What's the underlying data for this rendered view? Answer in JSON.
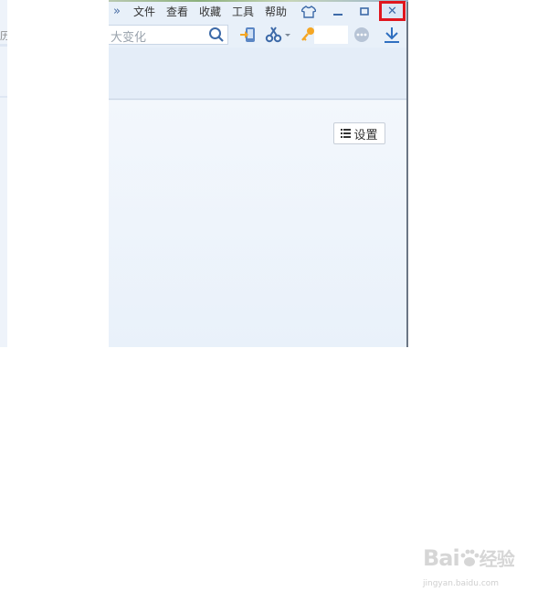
{
  "menu": {
    "more": "»",
    "items": [
      "文件",
      "查看",
      "收藏",
      "工具",
      "帮助"
    ]
  },
  "window_controls": {
    "skin": "shirt-icon",
    "minimize": "–",
    "maximize": "□",
    "close": "✕"
  },
  "toolbar": {
    "search_text": "大变化",
    "icons": [
      "search-icon",
      "phone-transfer-icon",
      "scissors-icon",
      "key-icon",
      "more-icon",
      "download-icon"
    ]
  },
  "left_glyph": "历",
  "content": {
    "settings_label": "设置"
  },
  "watermark": {
    "brand": "Bai",
    "brand2": "经验",
    "url": "jingyan.baidu.com"
  },
  "colors": {
    "accent": "#3d6aa8",
    "close_highlight": "#e0161e"
  }
}
